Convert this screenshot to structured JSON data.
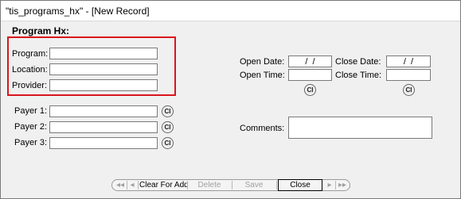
{
  "window": {
    "title": "\"tis_programs_hx\" - [New Record]"
  },
  "section": {
    "title": "Program Hx:"
  },
  "fields": {
    "program": {
      "label": "Program:",
      "value": ""
    },
    "location": {
      "label": "Location:",
      "value": ""
    },
    "provider": {
      "label": "Provider:",
      "value": ""
    },
    "payer1": {
      "label": "Payer 1:",
      "value": ""
    },
    "payer2": {
      "label": "Payer 2:",
      "value": ""
    },
    "payer3": {
      "label": "Payer 3:",
      "value": ""
    },
    "open_date": {
      "label": "Open Date:",
      "value": " /  / "
    },
    "close_date": {
      "label": "Close Date:",
      "value": " /  / "
    },
    "open_time": {
      "label": "Open Time:",
      "value": ""
    },
    "close_time": {
      "label": "Close Time:",
      "value": ""
    },
    "comments": {
      "label": "Comments:",
      "value": ""
    }
  },
  "ci_button": {
    "label": "CI"
  },
  "toolbar": {
    "first": "◂◂",
    "prev": "◂",
    "clear_for_add": "Clear For Add",
    "delete": "Delete",
    "save": "Save",
    "close": "Close",
    "next": "▸",
    "last": "▸▸"
  },
  "colors": {
    "highlight": "#d8161e",
    "field_border": "#7a7a7a",
    "background": "#f0f0f0"
  }
}
